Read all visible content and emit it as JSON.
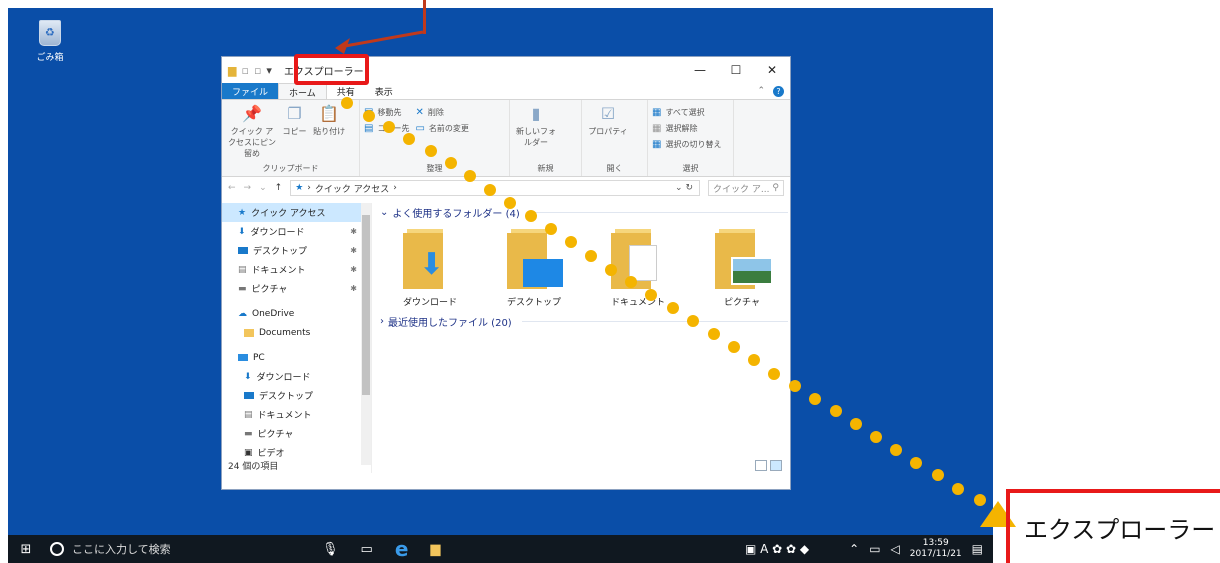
{
  "desktop": {
    "recycle_label": "ごみ箱"
  },
  "explorer": {
    "title": "エクスプローラー",
    "tabs": [
      "ファイル",
      "ホーム",
      "共有",
      "表示"
    ],
    "ribbon": {
      "clipboard": {
        "quick_access": "クイック アクセスにピン留め",
        "copy": "コピー",
        "paste": "貼り付け",
        "group": "クリップボード"
      },
      "organize": {
        "move_to": "移動先",
        "delete": "削除",
        "copy_to": "コピー先",
        "rename": "名前の変更",
        "group": "整理"
      },
      "new": {
        "new_folder": "新しいフォルダー",
        "group": "新規"
      },
      "open": {
        "properties": "プロパティ",
        "group": "開く"
      },
      "select": {
        "select_all": "すべて選択",
        "select_none": "選択解除",
        "invert": "選択の切り替え",
        "group": "選択"
      }
    },
    "address": {
      "path": "クイック アクセス",
      "search_placeholder": "クイック ア..."
    },
    "nav": {
      "quick_access": "クイック アクセス",
      "downloads": "ダウンロード",
      "desktop": "デスクトップ",
      "documents": "ドキュメント",
      "pictures": "ピクチャ",
      "onedrive": "OneDrive",
      "od_documents": "Documents",
      "pc": "PC",
      "pc_downloads": "ダウンロード",
      "pc_desktop": "デスクトップ",
      "pc_documents": "ドキュメント",
      "pc_pictures": "ピクチャ",
      "pc_videos": "ビデオ"
    },
    "content": {
      "frequent_header": "よく使用するフォルダー (4)",
      "recent_header": "最近使用したファイル (20)",
      "folders": [
        "ダウンロード",
        "デスクトップ",
        "ドキュメント",
        "ピクチャ"
      ]
    },
    "status": "24 個の項目"
  },
  "taskbar": {
    "search_placeholder": "ここに入力して検索",
    "time": "13:59",
    "date": "2017/11/21"
  },
  "callout": {
    "label": "エクスプローラー"
  }
}
